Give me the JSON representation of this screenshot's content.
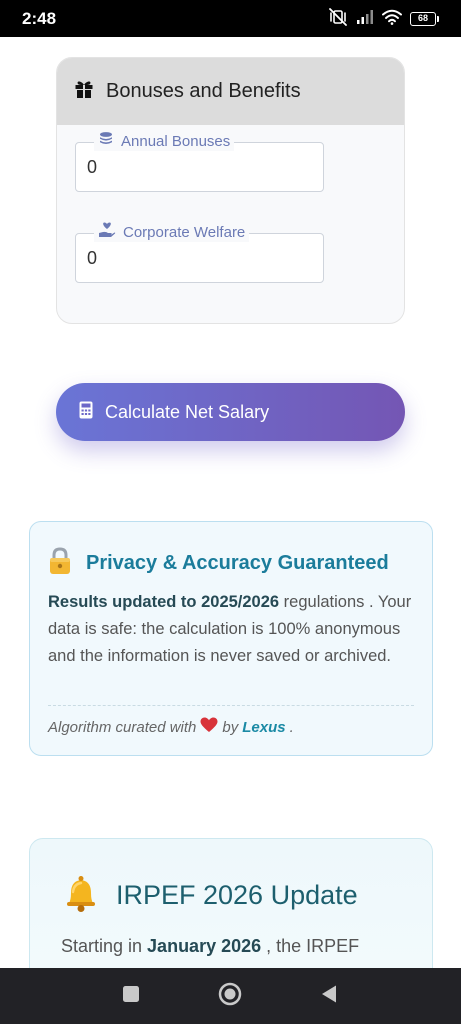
{
  "status_bar": {
    "time": "2:48",
    "battery": "68",
    "icons": [
      "vibrate-off-icon",
      "signal-icon",
      "wifi-icon",
      "battery-icon"
    ]
  },
  "bonuses_card": {
    "title": "Bonuses and Benefits",
    "icon": "gift-icon",
    "fields": [
      {
        "label": "Annual Bonuses",
        "value": "0",
        "icon": "coins-icon"
      },
      {
        "label": "Corporate Welfare",
        "value": "0",
        "icon": "hand-heart-icon"
      }
    ]
  },
  "calculate_button": {
    "label": "Calculate Net Salary",
    "icon": "calculator-icon"
  },
  "privacy_card": {
    "icon": "lock-icon",
    "title": "Privacy & Accuracy Guaranteed",
    "text_strong": "Results updated to 2025/2026",
    "text_rest": " regulations . Your data is safe: the calculation is 100% anonymous and the information is never saved or archived.",
    "footer_prefix": "Algorithm curated with",
    "footer_by": "by",
    "footer_author": "Lexus",
    "footer_suffix": "."
  },
  "irpef_card": {
    "icon": "bell-icon",
    "title": "IRPEF 2026 Update",
    "text_prefix": "Starting in ",
    "text_strong": "January 2026",
    "text_suffix": " , the IRPEF"
  },
  "nav_bar": {
    "buttons": [
      "recents-button",
      "home-button",
      "back-button"
    ]
  },
  "colors": {
    "accent_start": "#6a75d6",
    "accent_end": "#7456b4",
    "privacy_title": "#1b7c9b",
    "irpef_title": "#1d5f6e"
  }
}
